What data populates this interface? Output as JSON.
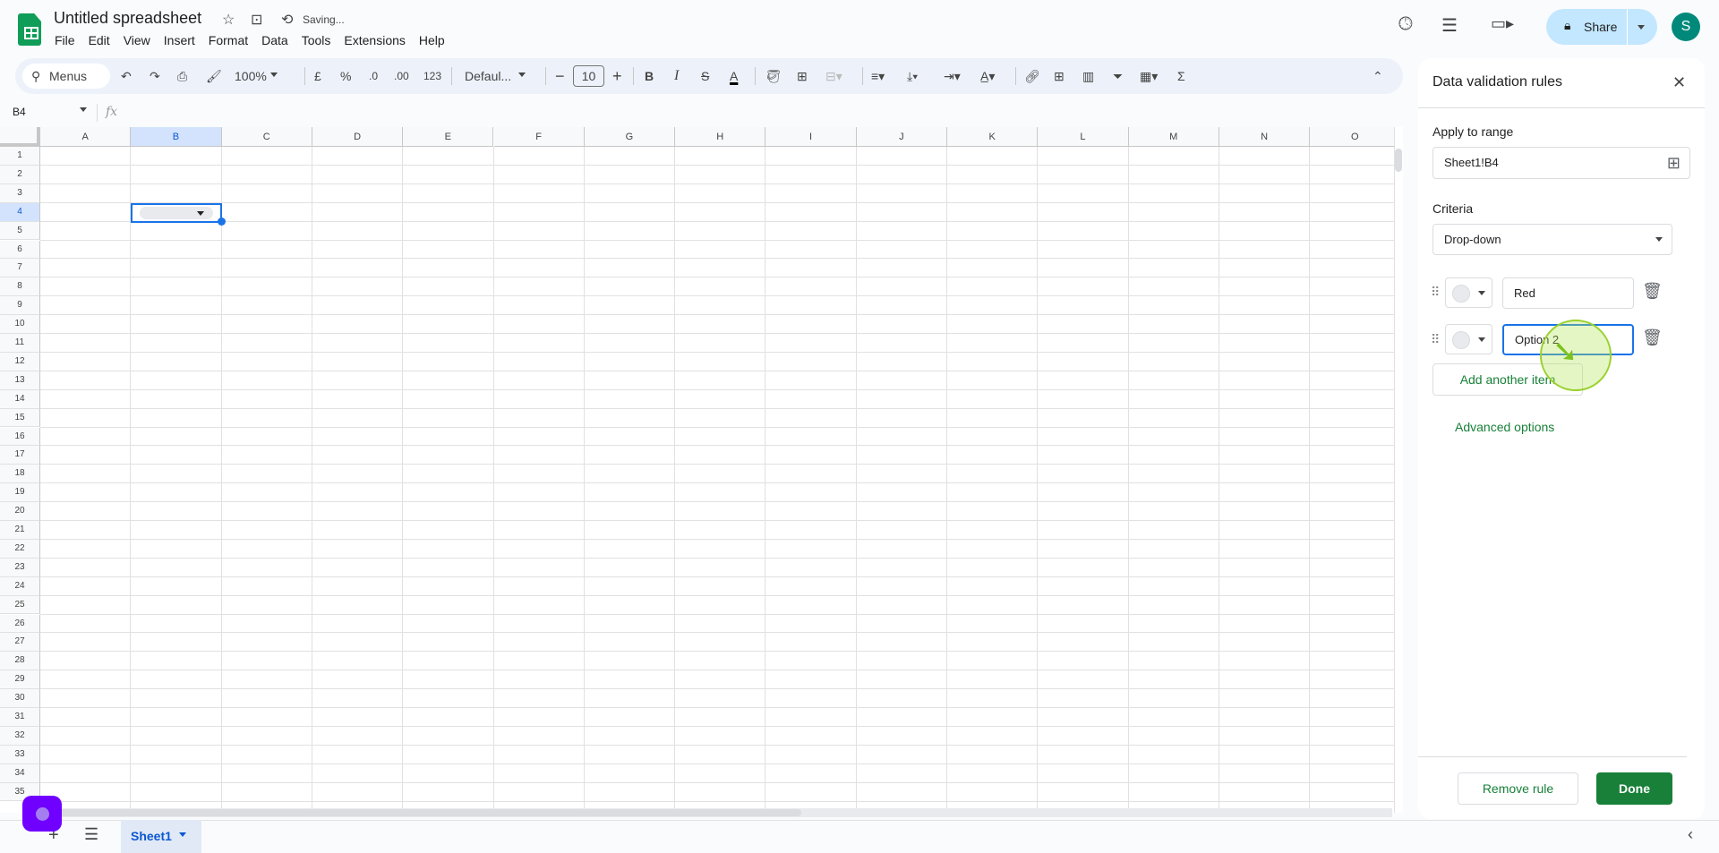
{
  "header": {
    "title": "Untitled spreadsheet",
    "status": "Saving...",
    "share_label": "Share",
    "avatar_letter": "S"
  },
  "menu": [
    "File",
    "Edit",
    "View",
    "Insert",
    "Format",
    "Data",
    "Tools",
    "Extensions",
    "Help"
  ],
  "toolbar": {
    "menus_label": "Menus",
    "zoom": "100%",
    "currency": "£",
    "percent": "%",
    "dec_decrease": ".0",
    "dec_increase": ".00",
    "number_format": "123",
    "font": "Defaul...",
    "font_size": "10",
    "bold": "B",
    "italic": "I",
    "strike": "S",
    "text_color": "A",
    "sigma": "Σ"
  },
  "formula_bar": {
    "name_box": "B4",
    "fx": "fx"
  },
  "grid": {
    "columns": [
      "A",
      "B",
      "C",
      "D",
      "E",
      "F",
      "G",
      "H",
      "I",
      "J",
      "K",
      "L",
      "M",
      "N",
      "O"
    ],
    "row_count": 35,
    "selected_cell": "B4"
  },
  "sheets": [
    {
      "name": "Sheet1"
    }
  ],
  "panel": {
    "title": "Data validation rules",
    "apply_label": "Apply to range",
    "range_value": "Sheet1!B4",
    "criteria_label": "Criteria",
    "criteria_value": "Drop-down",
    "items": [
      {
        "value": "Red",
        "focused": false
      },
      {
        "value": "Option 2",
        "focused": true
      }
    ],
    "add_item": "Add another item",
    "advanced": "Advanced options",
    "remove_rule": "Remove rule",
    "done": "Done"
  },
  "colors": {
    "accent": "#1a73e8",
    "done_green": "#188038",
    "share_bg": "#c2e7ff",
    "selection": "#d3e3fd"
  }
}
